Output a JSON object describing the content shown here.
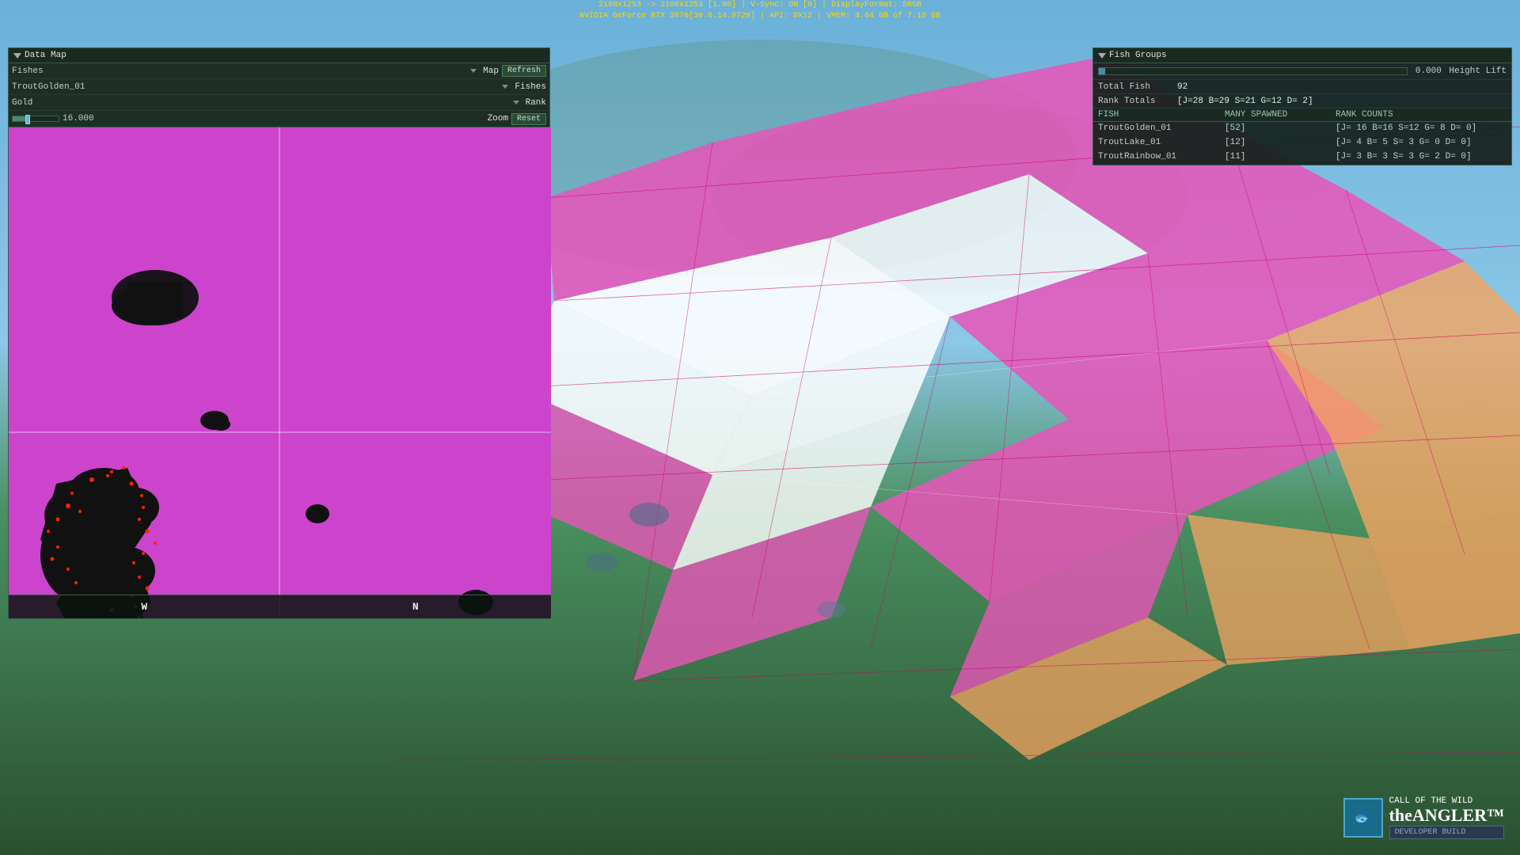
{
  "hud": {
    "line1": "2108x1253 -> 2108x1253 [1.00] | V-Sync: ON [0] | DisplayFormat: SRGB",
    "line2": "NVIDIA GeForce RTX 3070[30.0.14.9729] | API: DX12 | VMEM: 4.64 GB of 7.10 GB"
  },
  "data_map": {
    "title": "Data Map",
    "filter_label": "Fishes",
    "selected_fish": "TroutGolden_01",
    "rank_label": "Gold",
    "map_label": "Map",
    "refresh_label": "Refresh",
    "fishes_label": "Fishes",
    "rank_dropdown_label": "Rank",
    "zoom_label": "Zoom",
    "reset_label": "Reset",
    "zoom_value": "16.000",
    "compass_w": "W",
    "compass_n": "N"
  },
  "fish_groups": {
    "title": "Fish Groups",
    "height_value": "0.000",
    "height_lift_label": "Height Lift",
    "total_fish_label": "Total Fish",
    "total_fish_value": "92",
    "rank_totals_label": "Rank Totals",
    "rank_totals_value": "[J=28 B=29 S=21 G=12 D= 2]",
    "table_headers": {
      "fish": "FISH",
      "spawned": "MANY SPAWNED",
      "rank": "RANK COUNTS"
    },
    "fish_rows": [
      {
        "name": "TroutGolden_01",
        "spawned": "[52]",
        "rank": "[J= 16 B=16 S=12 G= 8 D= 0]"
      },
      {
        "name": "TroutLake_01",
        "spawned": "[12]",
        "rank": "[J= 4 B= 5 S= 3 G= 0 D= 0]"
      },
      {
        "name": "TroutRainbow_01",
        "spawned": "[11]",
        "rank": "[J= 3 B= 3 S= 3 G= 2 D= 0]"
      }
    ]
  },
  "watermark": {
    "title_line1": "CALL OF THE WILD",
    "title_line2": "theANGLER™",
    "badge": "DEVELOPER BUILD"
  },
  "colors": {
    "map_bg": "#cc44cc",
    "panel_bg": "rgba(20,30,25,0.92)",
    "accent": "#4a8a6a"
  }
}
